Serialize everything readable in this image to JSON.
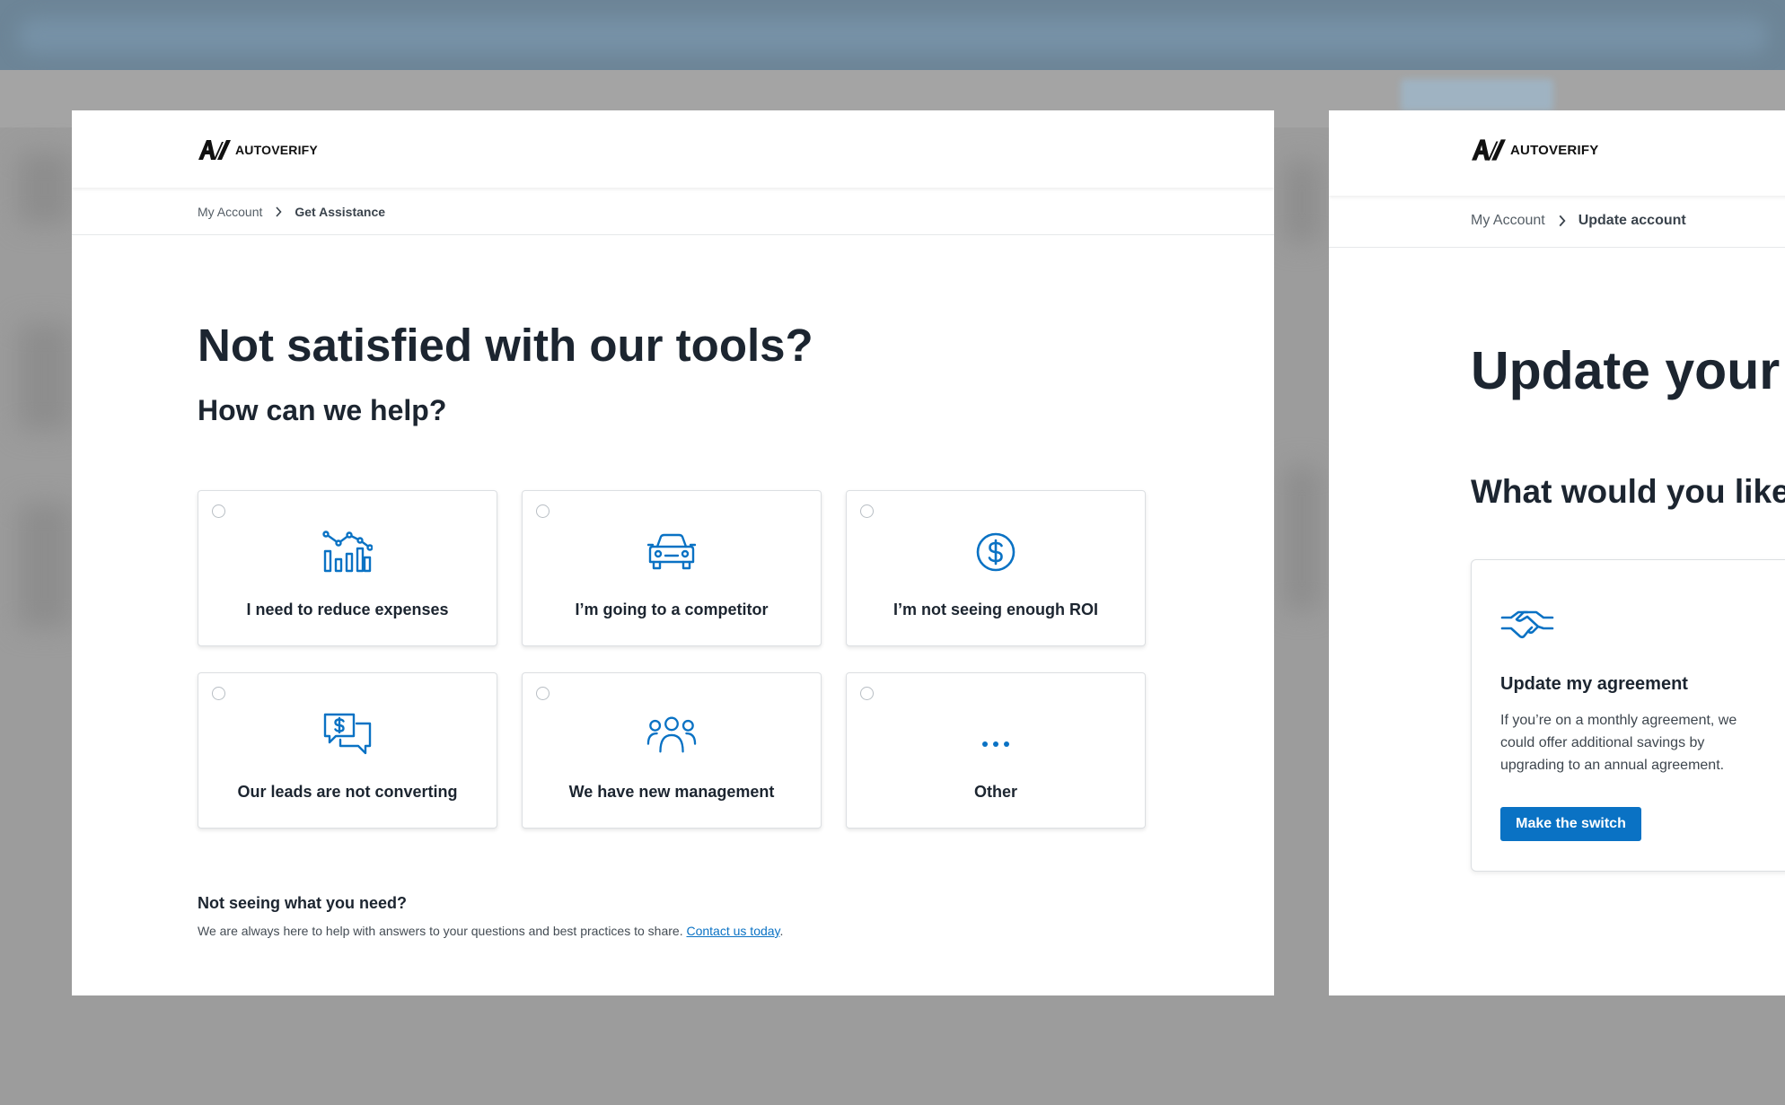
{
  "left_panel": {
    "logo": {
      "mark": "A/",
      "text": "AUTOVERIFY"
    },
    "breadcrumb": {
      "parent": "My Account",
      "current": "Get Assistance"
    },
    "title": "Not satisfied with our tools?",
    "subtitle": "How can we help?",
    "options": [
      {
        "label": "I need to reduce expenses",
        "icon": "bar-chart-trend-icon"
      },
      {
        "label": "I’m going to a competitor",
        "icon": "car-icon"
      },
      {
        "label": "I’m not seeing enough ROI",
        "icon": "dollar-coin-icon"
      },
      {
        "label": "Our leads are not converting",
        "icon": "chat-bubbles-dollar-icon"
      },
      {
        "label": "We have new management",
        "icon": "people-group-icon"
      },
      {
        "label": "Other",
        "icon": "ellipsis-icon"
      }
    ],
    "help": {
      "title": "Not seeing what you need?",
      "text": "We are always here to help with answers to your questions and best practices to share.",
      "link_text": "Contact us today",
      "trailing": "."
    }
  },
  "right_panel": {
    "logo": {
      "mark": "A/",
      "text": "AUTOVERIFY"
    },
    "breadcrumb": {
      "parent": "My Account",
      "current": "Update account"
    },
    "title": "Update your a",
    "subtitle": "What would you like t",
    "card": {
      "icon": "handshake-icon",
      "title": "Update my agreement",
      "description": "If you’re on a monthly agreement, we could offer additional savings by upgrading to an annual agreement.",
      "button_label": "Make the switch"
    }
  },
  "colors": {
    "accent": "#0a72c4",
    "text": "#1c2530",
    "backdrop": "#9c9c9c"
  }
}
